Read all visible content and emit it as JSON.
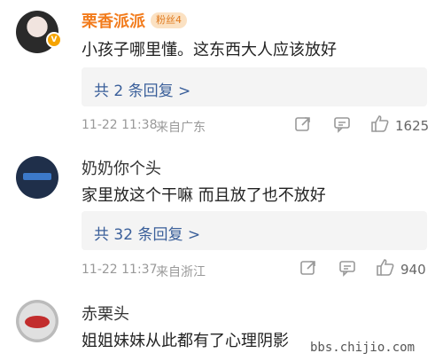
{
  "comments": [
    {
      "username": "栗香派派",
      "badge": "粉丝4",
      "text": "小孩子哪里懂。这东西大人应该放好",
      "replies": "共 2 条回复 >",
      "time": "11-22 11:38",
      "location": "来自广东",
      "likes": "1625"
    },
    {
      "username": "奶奶你个头",
      "text": "家里放这个干嘛 而且放了也不放好",
      "replies": "共 32 条回复 >",
      "time": "11-22 11:37",
      "location": "来自浙江",
      "likes": "940"
    },
    {
      "username": "赤栗头",
      "text": "姐姐妹妹从此都有了心理阴影"
    }
  ],
  "watermark": "bbs.chijio.com"
}
